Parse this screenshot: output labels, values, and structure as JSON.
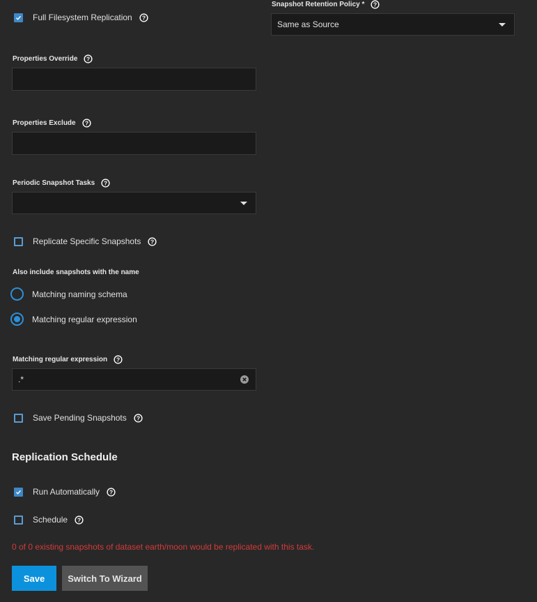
{
  "full_filesystem_replication": {
    "label": "Full Filesystem Replication",
    "checked": true
  },
  "snapshot_retention_policy": {
    "label": "Snapshot Retention Policy",
    "required_mark": "*",
    "value": "Same as Source"
  },
  "properties_override": {
    "label": "Properties Override",
    "value": ""
  },
  "properties_exclude": {
    "label": "Properties Exclude",
    "value": ""
  },
  "periodic_snapshot_tasks": {
    "label": "Periodic Snapshot Tasks",
    "value": ""
  },
  "replicate_specific_snapshots": {
    "label": "Replicate Specific Snapshots",
    "checked": false
  },
  "also_include": {
    "label": "Also include snapshots with the name",
    "options": [
      {
        "label": "Matching naming schema",
        "selected": false
      },
      {
        "label": "Matching regular expression",
        "selected": true
      }
    ]
  },
  "matching_regex": {
    "label": "Matching regular expression",
    "value": ".*"
  },
  "save_pending_snapshots": {
    "label": "Save Pending Snapshots",
    "checked": false
  },
  "replication_schedule": {
    "title": "Replication Schedule",
    "run_automatically": {
      "label": "Run Automatically",
      "checked": true
    },
    "schedule": {
      "label": "Schedule",
      "checked": false
    }
  },
  "warning_text": "0 of 0 existing snapshots of dataset earth/moon would be replicated with this task.",
  "buttons": {
    "save": "Save",
    "switch_wizard": "Switch To Wizard"
  },
  "colors": {
    "accent": "#0c92dc",
    "warning": "#d33a3a",
    "background": "#282828",
    "field_bg": "#1a1a1a"
  },
  "icons": {
    "help": "help-circle-icon",
    "check": "check-icon",
    "dropdown": "dropdown-arrow-icon",
    "clear": "clear-circle-icon"
  }
}
